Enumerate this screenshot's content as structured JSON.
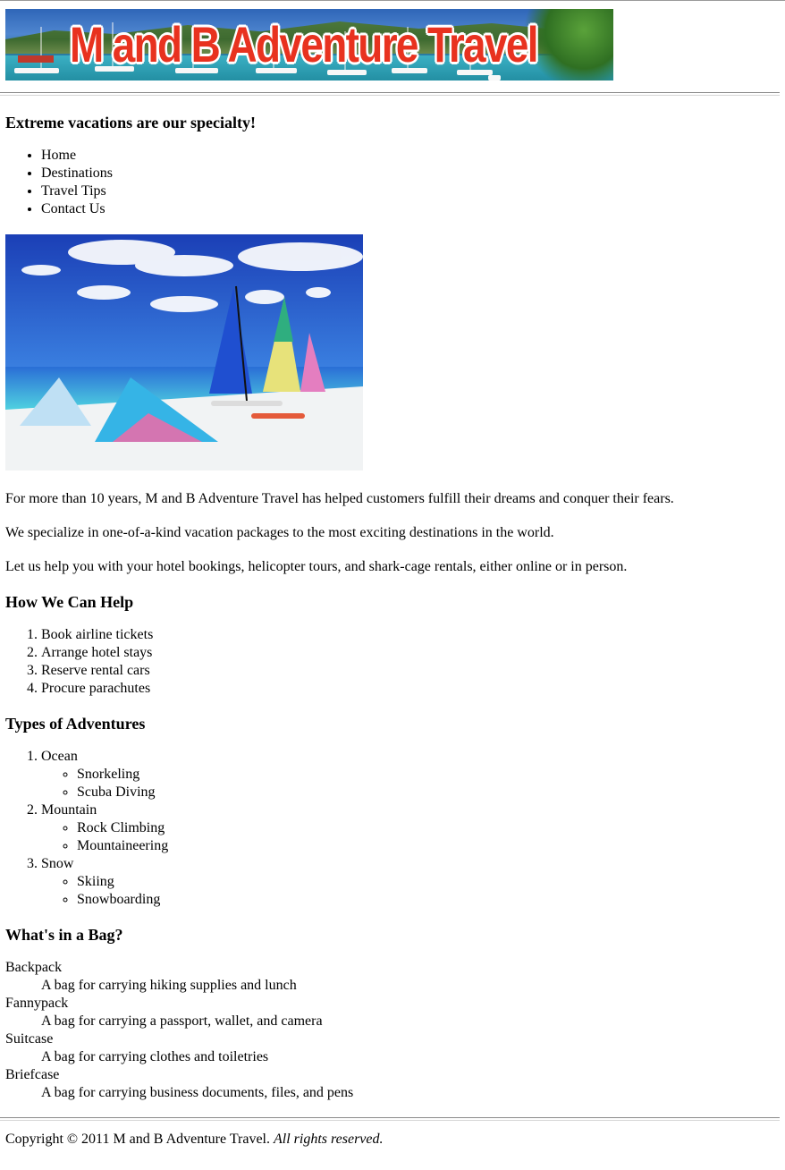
{
  "banner": {
    "title": "M and B Adventure Travel",
    "colors": {
      "title_fill": "#e8321f",
      "title_outline": "#ffffff"
    }
  },
  "tagline": "Extreme vacations are our specialty!",
  "nav": {
    "items": [
      {
        "label": "Home"
      },
      {
        "label": "Destinations"
      },
      {
        "label": "Travel Tips"
      },
      {
        "label": "Contact Us"
      }
    ]
  },
  "intro": {
    "paragraphs": [
      "For more than 10 years, M and B Adventure Travel has helped customers fulfill their dreams and conquer their fears.",
      "We specialize in one-of-a-kind vacation packages to the most exciting destinations in the world.",
      "Let us help you with your hotel bookings, helicopter tours, and shark-cage rentals, either online or in person."
    ]
  },
  "help": {
    "heading": "How We Can Help",
    "items": [
      "Book airline tickets",
      "Arrange hotel stays",
      "Reserve rental cars",
      "Procure parachutes"
    ]
  },
  "adventures": {
    "heading": "Types of Adventures",
    "categories": [
      {
        "label": "Ocean",
        "items": [
          "Snorkeling",
          "Scuba Diving"
        ]
      },
      {
        "label": "Mountain",
        "items": [
          "Rock Climbing",
          "Mountaineering"
        ]
      },
      {
        "label": "Snow",
        "items": [
          "Skiing",
          "Snowboarding"
        ]
      }
    ]
  },
  "bags": {
    "heading": "What's in a Bag?",
    "entries": [
      {
        "term": "Backpack",
        "definition": "A bag for carrying hiking supplies and lunch"
      },
      {
        "term": "Fannypack",
        "definition": "A bag for carrying a passport, wallet, and camera"
      },
      {
        "term": "Suitcase",
        "definition": "A bag for carrying clothes and toiletries"
      },
      {
        "term": "Briefcase",
        "definition": "A bag for carrying business documents, files, and pens"
      }
    ]
  },
  "footer": {
    "copyright": "Copyright © 2011 M and B Adventure Travel.",
    "rights": "All rights reserved."
  }
}
